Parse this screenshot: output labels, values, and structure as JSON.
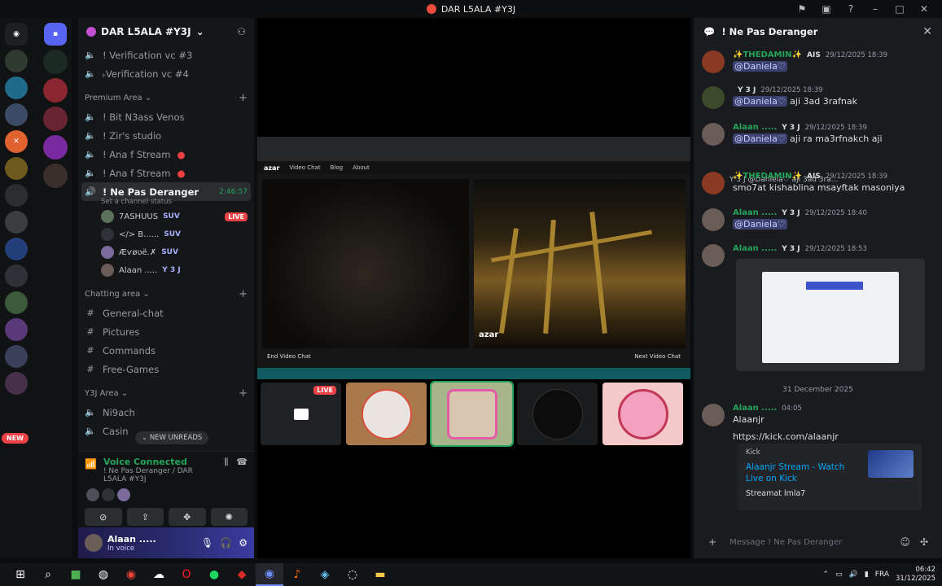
{
  "window": {
    "title": "DAR L5ALA #Y3J"
  },
  "guild": {
    "name": "DAR L5ALA #Y3J",
    "channels_top": [
      {
        "label": "! Verification vc #3"
      },
      {
        "label": "˫Verification vc #4"
      }
    ],
    "categories": {
      "premium": "Premium Area",
      "chatting": "Chatting area",
      "y3j": "Y3J Area"
    },
    "premium_channels": [
      {
        "label": "! Bit N3ass Venos"
      },
      {
        "label": "! Zir's studio"
      },
      {
        "label": "! Ana f Stream"
      },
      {
        "label": "! Ana f Stream"
      }
    ],
    "active_channel": {
      "label": "! Ne Pas Deranger",
      "timer": "2:46:57",
      "status_prompt": "Set a channel status"
    },
    "voice_users": [
      {
        "name": "7ASHUUS",
        "tag": "SUV",
        "live": "LIVE"
      },
      {
        "name": "</> B......",
        "tag": "SUV"
      },
      {
        "name": "Æѵøʋë.✗",
        "tag": "SUV"
      },
      {
        "name": "Alaan .....",
        "tag": "Y 3 J"
      }
    ],
    "chatting_channels": [
      {
        "label": "General-chat"
      },
      {
        "label": "Pictures"
      },
      {
        "label": "Commands"
      },
      {
        "label": "Free-Games"
      }
    ],
    "y3j_channels": [
      {
        "label": "Ni9ach"
      },
      {
        "label": "Casin"
      }
    ],
    "new_unreads": "NEW UNREADS",
    "new_badge": "NEW"
  },
  "voice_panel": {
    "status": "Voice Connected",
    "location": "! Ne Pas Deranger / DAR L5ALA #Y3J"
  },
  "user_panel": {
    "name": "Alaan .....",
    "status": "In voice"
  },
  "stage": {
    "azar_nav": [
      "Video Chat",
      "Blog",
      "About"
    ],
    "azar_brand": "azar",
    "end_label": "End Video Chat",
    "next_label": "Next Video Chat",
    "live_badge": "LIVE"
  },
  "chat": {
    "channel": "! Ne Pas Deranger",
    "messages": [
      {
        "author": "✨THEDAMIN✨",
        "role": "AIS",
        "time": "29/12/2025 18:39",
        "mention": "@Daniela♡",
        "text": ""
      },
      {
        "author": "",
        "role": "Y 3 J",
        "time": "29/12/2025 18:39",
        "mention": "@Daniela♡",
        "text": "aji 3ad 3rafnak"
      },
      {
        "author": "Alaan .....",
        "role": "Y 3 J",
        "time": "29/12/2025 18:39",
        "mention": "@Daniela♡",
        "text": "aji ra ma3rfnakch aji"
      },
      {
        "author": "✨THEDAMIN✨",
        "role": "AIS",
        "time": "29/12/2025 18:39",
        "mention": "",
        "text": "smo7at kishablina msayftak masoniya"
      },
      {
        "author": "Alaan .....",
        "role": "Y 3 J",
        "time": "29/12/2025 18:40",
        "mention": "@Daniela♡",
        "text": ""
      },
      {
        "author": "Alaan .....",
        "role": "Y 3 J",
        "time": "29/12/2025 18:53",
        "mention": "",
        "text": ""
      }
    ],
    "reply_preview": "Y 3 J  @Daniela♡ aji 3ad 3ra...",
    "date_separator": "31 December 2025",
    "last": {
      "author": "Alaan .....",
      "time": "04:05",
      "text": "Alaanjr",
      "link": "https://kick.com/alaanjr",
      "embed_provider": "Kick",
      "embed_title": "Alaanjr Stream - Watch Live on Kick",
      "embed_desc": "Streamat lmla7"
    },
    "composer_placeholder": "Message ! Ne Pas Deranger"
  },
  "taskbar": {
    "lang": "FRA",
    "time": "06:42",
    "date": "31/12/2025"
  },
  "colors": {
    "accent": "#5865f2",
    "online": "#23a55a",
    "danger": "#ed4245",
    "link": "#00a8fc"
  }
}
